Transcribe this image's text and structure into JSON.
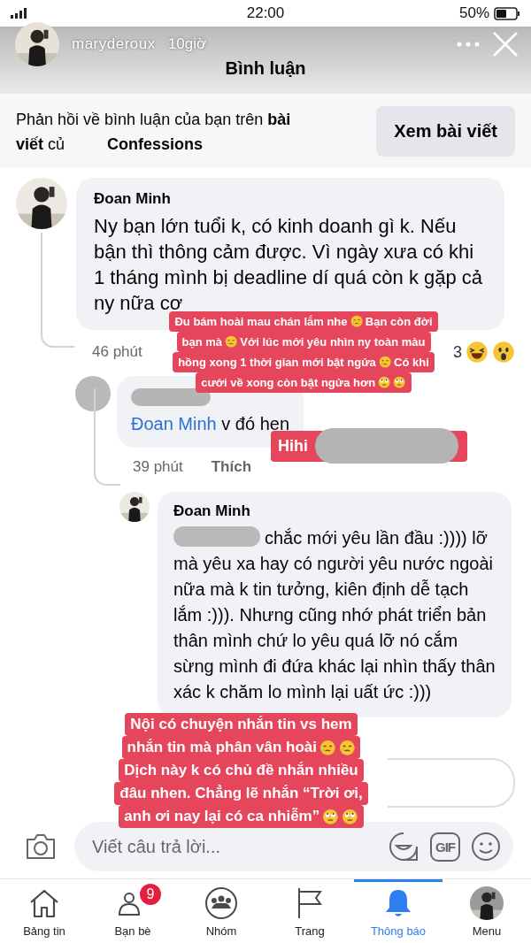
{
  "status_bar": {
    "time": "22:00",
    "battery": "50%"
  },
  "story": {
    "username": "maryderoux",
    "age": "10giờ"
  },
  "header": {
    "title": "Bình luận"
  },
  "notice": {
    "lines": [
      "Phản hồi về bình luận của bạn trên **bài**",
      "**viết** củ"
    ],
    "page": "Confessions",
    "button": "Xem bài viết"
  },
  "comments": [
    {
      "author": "Đoan Minh",
      "text": "Ny bạn lớn tuổi k, có kinh doanh gì k. Nếu bận thì thông cảm được. Vì ngày xưa có khi 1 tháng mình bị deadline dí quá còn k gặp cả ny nữa cơ",
      "time": "46 phút",
      "reaction_count": "3",
      "children": [
        {
          "author_blurred": true,
          "mention": "Đoan Minh",
          "text": "v đó hen",
          "time": "39 phút",
          "like": "Thích",
          "children": [
            {
              "author": "Đoan Minh",
              "text_blurred": true,
              "text": "chắc mới yêu lần đầu :)))) lỡ mà yêu xa hay có người yêu nước ngoài nữa mà k tin tưởng, kiên định dễ tạch lắm :))). Nhưng cũng nhớ phát triển bản thân mình chứ lo yêu quá lỡ nó cắm sừng mình đi đứa khác lại nhìn thấy thân xác k chăm lo mình lại uất ức :)))"
            }
          ]
        }
      ]
    }
  ],
  "composer": {
    "placeholder": "Viết câu trả lời...",
    "gif": "GIF"
  },
  "tabs": [
    {
      "label": "Bảng tin",
      "selected": false
    },
    {
      "label": "Bạn bè",
      "badge": "9",
      "selected": false
    },
    {
      "label": "Nhóm",
      "selected": false
    },
    {
      "label": "Trang",
      "selected": false
    },
    {
      "label": "Thông báo",
      "selected": true
    },
    {
      "label": "Menu",
      "selected": false
    }
  ],
  "stickers": [
    {
      "lines": [
        [
          {
            "kind": "text",
            "text": "Đu bám hoài mau chán lắm nhe"
          },
          {
            "kind": "tearful_emoji"
          },
          {
            "kind": "text",
            "text": "Bạn còn đời"
          }
        ],
        [
          {
            "kind": "text",
            "text": "bạn mà"
          },
          {
            "kind": "tearful_emoji"
          },
          {
            "kind": "text",
            "text": "Với lúc mới yêu nhìn ny toàn màu"
          }
        ],
        [
          {
            "kind": "text",
            "text": "hồng xong 1 thời gian mới bật ngửa"
          },
          {
            "kind": "tearful_emoji"
          },
          {
            "kind": "text",
            "text": "Có khi"
          }
        ],
        [
          {
            "kind": "text",
            "text": "cưới về xong còn bật ngửa hơn"
          },
          {
            "kind": "eye_roll_emoji"
          },
          {
            "kind": "eye_roll_emoji"
          }
        ]
      ]
    },
    {
      "blur_after": true,
      "lines": [
        [
          {
            "kind": "text",
            "text": "Hihi"
          }
        ]
      ]
    },
    {
      "lines": [
        [
          {
            "kind": "text",
            "text": "Nội có chuyện nhắn tin vs hem"
          }
        ],
        [
          {
            "kind": "text",
            "text": "nhắn tin mà phân vân hoài"
          },
          {
            "kind": "tearful_emoji"
          },
          {
            "kind": "tearful_emoji"
          }
        ],
        [
          {
            "kind": "text",
            "text": "Dịch này k có chủ đề nhắn nhiều"
          }
        ],
        [
          {
            "kind": "text",
            "text": "đâu nhen. Chẳng lẽ nhắn “Trời ơi,"
          }
        ],
        [
          {
            "kind": "text",
            "text": "anh ơi nay lại có ca nhiễm”"
          },
          {
            "kind": "eye_roll_emoji"
          },
          {
            "kind": "eye_roll_emoji"
          }
        ]
      ]
    }
  ]
}
